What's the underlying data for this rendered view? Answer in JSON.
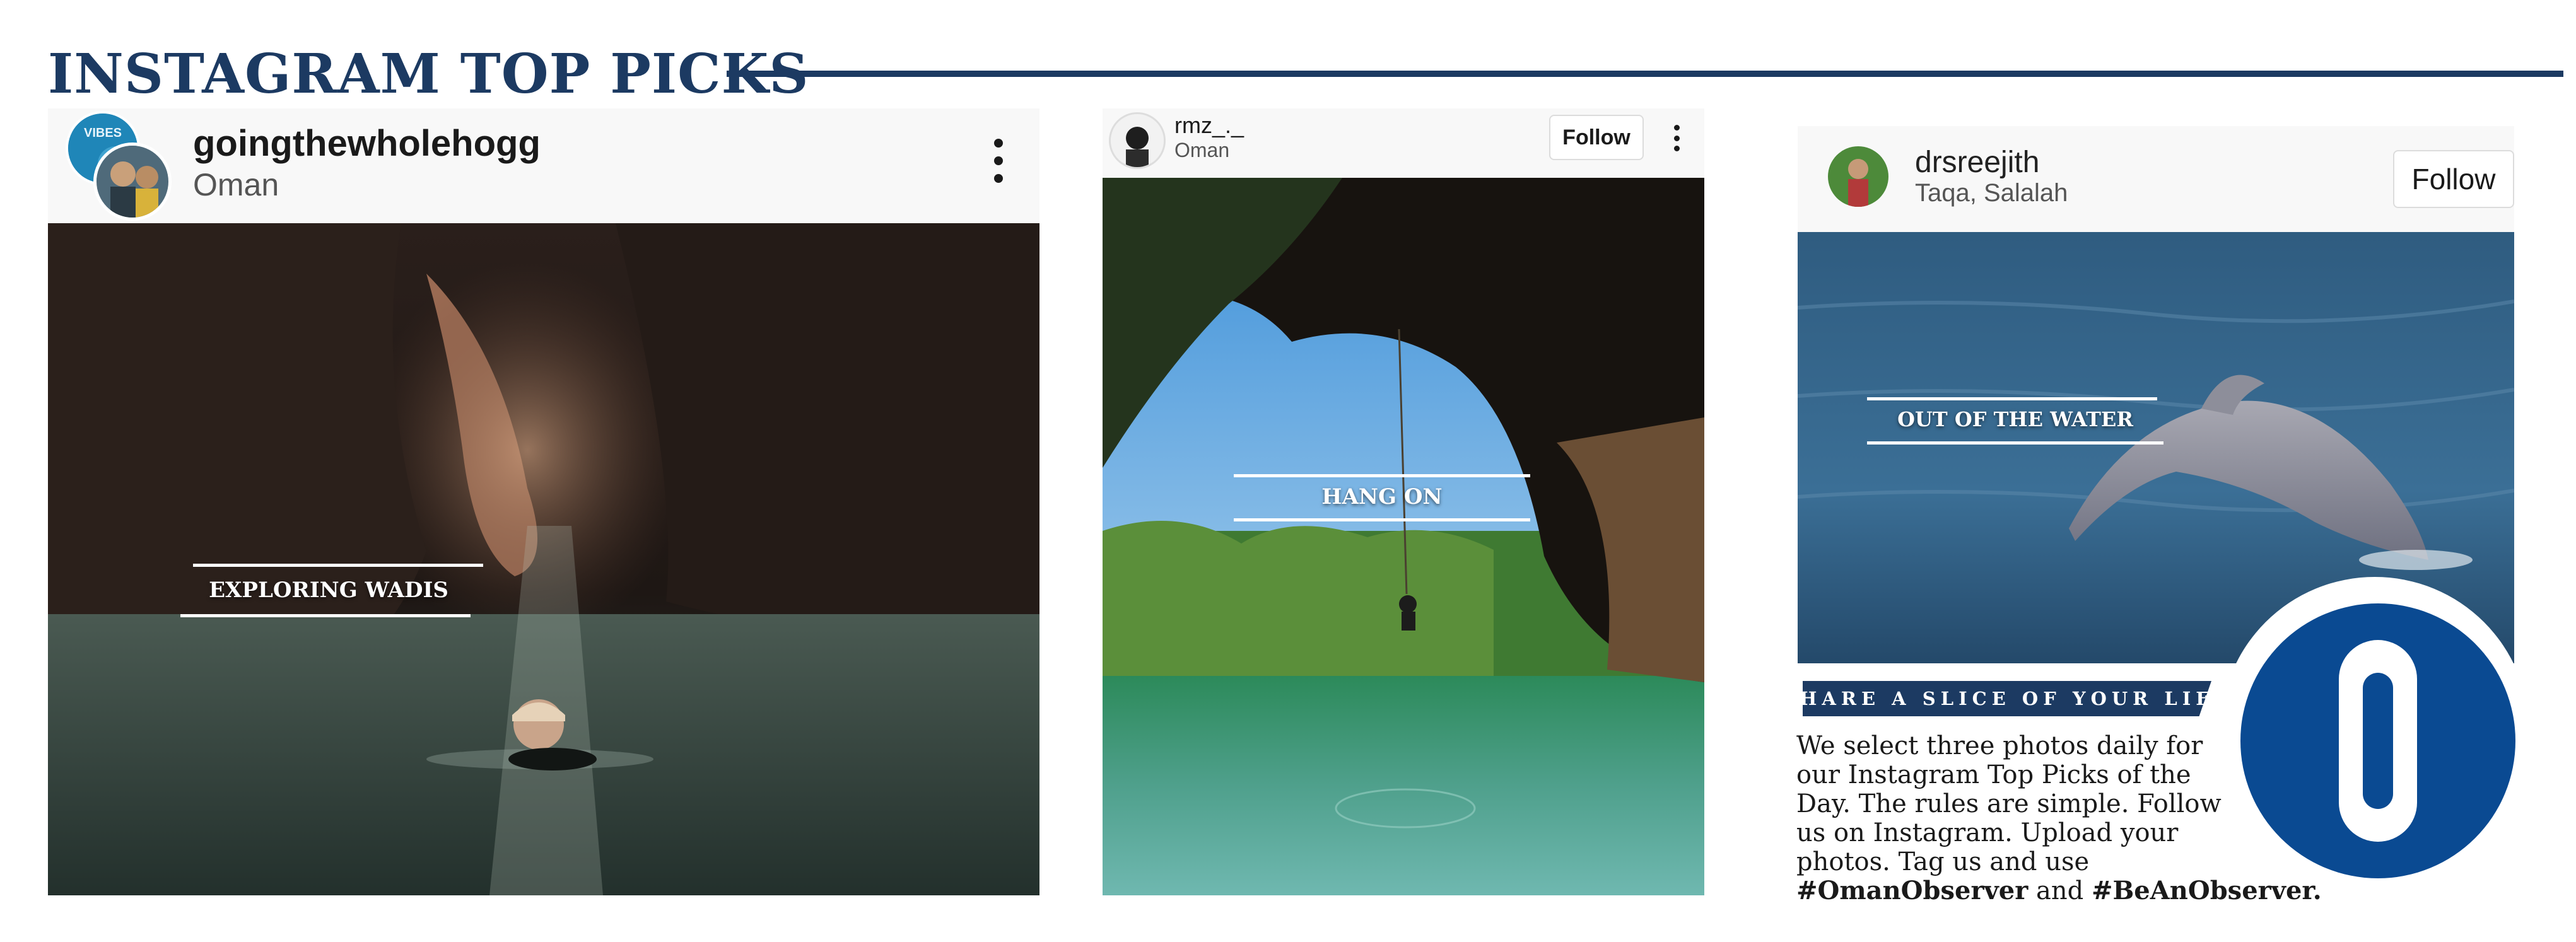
{
  "header": {
    "title": "INSTAGRAM TOP PICKS"
  },
  "posts": [
    {
      "username": "goingthewholehogg",
      "location": "Oman",
      "avatar_badge": "VIBES",
      "caption": "EXPLORING WADIS"
    },
    {
      "username": "rmz_._",
      "location": "Oman",
      "follow_label": "Follow",
      "caption": "HANG ON"
    },
    {
      "username": "drsreejith",
      "location": "Taqa, Salalah",
      "follow_label": "Follow",
      "caption": "OUT OF THE WATER"
    }
  ],
  "promo": {
    "banner": "SHARE A SLICE OF YOUR LIFE",
    "lines": [
      "We select three photos daily for",
      "our Instagram Top Picks of the",
      "Day. The rules are simple. Follow",
      "us on Instagram. Upload your",
      "photos. Tag us and use"
    ],
    "hashtag1": "#OmanObserver",
    "connector": "and",
    "hashtag2": "#BeAnObserver."
  },
  "logo": {
    "letter": "O",
    "color": "#0a4a92"
  },
  "colors": {
    "navy": "#1c3a62",
    "white": "#ffffff"
  },
  "icons": [
    "more-options-icon",
    "avatar-icon"
  ]
}
